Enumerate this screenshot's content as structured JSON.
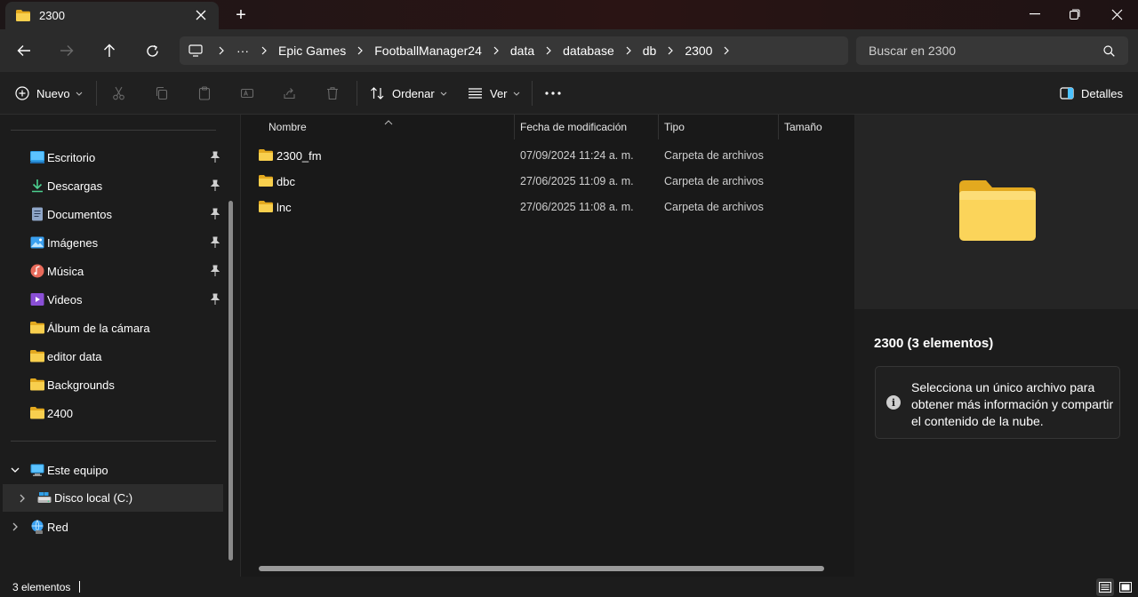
{
  "window": {
    "tab_title": "2300",
    "new_tab_symbol": "+"
  },
  "address": {
    "overflow": "···",
    "crumbs": [
      "Epic Games",
      "FootballManager24",
      "data",
      "database",
      "db",
      "2300"
    ]
  },
  "search": {
    "placeholder": "Buscar en 2300"
  },
  "toolbar": {
    "new_label": "Nuevo",
    "sort_label": "Ordenar",
    "view_label": "Ver",
    "details_label": "Detalles"
  },
  "sidebar": {
    "quick_access": [
      {
        "label": "Escritorio",
        "icon": "desktop-icon",
        "pinned": true
      },
      {
        "label": "Descargas",
        "icon": "download-icon",
        "pinned": true
      },
      {
        "label": "Documentos",
        "icon": "document-icon",
        "pinned": true
      },
      {
        "label": "Imágenes",
        "icon": "pictures-icon",
        "pinned": true
      },
      {
        "label": "Música",
        "icon": "music-icon",
        "pinned": true
      },
      {
        "label": "Videos",
        "icon": "videos-icon",
        "pinned": true
      },
      {
        "label": "Álbum de la cámara",
        "icon": "folder-icon",
        "pinned": false
      },
      {
        "label": "editor data",
        "icon": "folder-icon",
        "pinned": false
      },
      {
        "label": "Backgrounds",
        "icon": "folder-icon",
        "pinned": false
      },
      {
        "label": "2400",
        "icon": "folder-icon",
        "pinned": false
      }
    ],
    "this_pc": "Este equipo",
    "local_disk": "Disco local (C:)",
    "network": "Red"
  },
  "columns": {
    "name": "Nombre",
    "modified": "Fecha de modificación",
    "type": "Tipo",
    "size": "Tamaño"
  },
  "files": [
    {
      "name": "2300_fm",
      "modified": "07/09/2024 11:24 a. m.",
      "type": "Carpeta de archivos"
    },
    {
      "name": "dbc",
      "modified": "27/06/2025 11:09 a. m.",
      "type": "Carpeta de archivos"
    },
    {
      "name": "lnc",
      "modified": "27/06/2025 11:08 a. m.",
      "type": "Carpeta de archivos"
    }
  ],
  "details": {
    "title": "2300 (3 elementos)",
    "info": "Selecciona un único archivo para obtener más información y compartir el contenido de la nube.",
    "info_icon": "i"
  },
  "status": {
    "count": "3 elementos"
  },
  "colors": {
    "accent": "#4cc2ff",
    "folder_yellow": "#f4c542",
    "folder_back": "#e3a91f"
  }
}
